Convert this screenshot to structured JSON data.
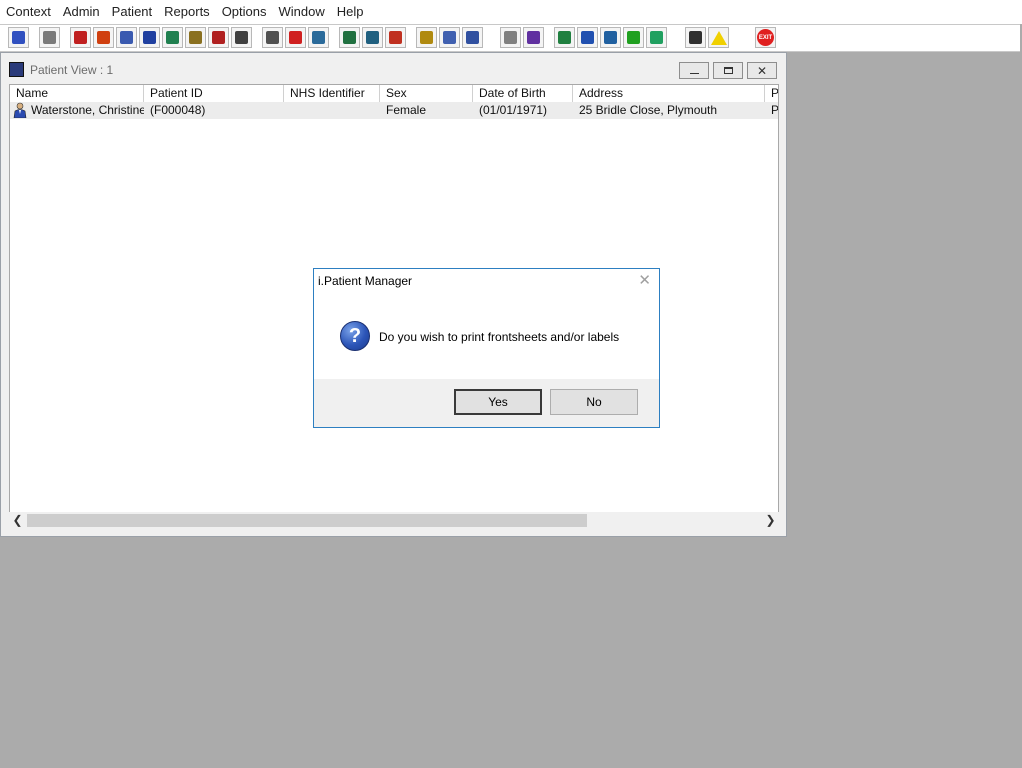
{
  "menu": [
    "Context",
    "Admin",
    "Patient",
    "Reports",
    "Options",
    "Window",
    "Help"
  ],
  "toolbar": {
    "buttons": [
      {
        "icon": "patient-icon",
        "color": "#3050c0"
      },
      {
        "icon": "printer-icon",
        "color": "#7a7a7a"
      },
      {
        "icon": "book-icon",
        "color": "#c02020"
      },
      {
        "icon": "edit-icon",
        "color": "#d04010"
      },
      {
        "icon": "image-icon",
        "color": "#3a5ab0"
      },
      {
        "icon": "letter-m-icon",
        "color": "#2040a0"
      },
      {
        "icon": "person-icon",
        "color": "#208050"
      },
      {
        "icon": "note-icon",
        "color": "#8a7020"
      },
      {
        "icon": "flag-icon",
        "color": "#b02020"
      },
      {
        "icon": "camera-icon",
        "color": "#404040"
      },
      {
        "icon": "magnify-icon",
        "color": "#505050"
      },
      {
        "icon": "clock-icon",
        "color": "#d02020"
      },
      {
        "icon": "monitor-icon",
        "color": "#2a6a9a"
      },
      {
        "icon": "chart-icon",
        "color": "#207040"
      },
      {
        "icon": "message-icon",
        "color": "#206080"
      },
      {
        "icon": "gauge-icon",
        "color": "#c03020"
      },
      {
        "icon": "notepad-icon",
        "color": "#b08a10"
      },
      {
        "icon": "transfer-icon",
        "color": "#4060b0"
      },
      {
        "icon": "people-icon",
        "color": "#3050a0"
      },
      {
        "icon": "document-icon",
        "color": "#808080"
      },
      {
        "icon": "bar-chart-icon",
        "color": "#6030a0"
      },
      {
        "icon": "globe-icon",
        "color": "#208040"
      },
      {
        "icon": "checklist-icon",
        "color": "#2050b0"
      },
      {
        "icon": "approve-icon",
        "color": "#2060a0"
      },
      {
        "icon": "download-icon",
        "color": "#20a020"
      },
      {
        "icon": "sync-icon",
        "color": "#20a060"
      },
      {
        "icon": "swap-icon",
        "color": "#303030"
      },
      {
        "icon": "warning-icon",
        "color": "#f0d000"
      },
      {
        "icon": "exit-icon",
        "color": "#e02020",
        "label": "EXIT"
      }
    ]
  },
  "window": {
    "title": "Patient View : 1",
    "columns": [
      "Name",
      "Patient ID",
      "NHS Identifier",
      "Sex",
      "Date of Birth",
      "Address",
      "P"
    ],
    "rows": [
      {
        "name": "Waterstone, Christine...",
        "patient_id": "(F000048)",
        "nhs": "",
        "sex": "Female",
        "dob": "(01/01/1971)",
        "address": "25 Bridle Close, Plymouth",
        "extra": "Pl"
      }
    ]
  },
  "dialog": {
    "title": "i.Patient Manager",
    "message": "Do you wish to print frontsheets and/or labels",
    "yes_label": "Yes",
    "no_label": "No"
  }
}
